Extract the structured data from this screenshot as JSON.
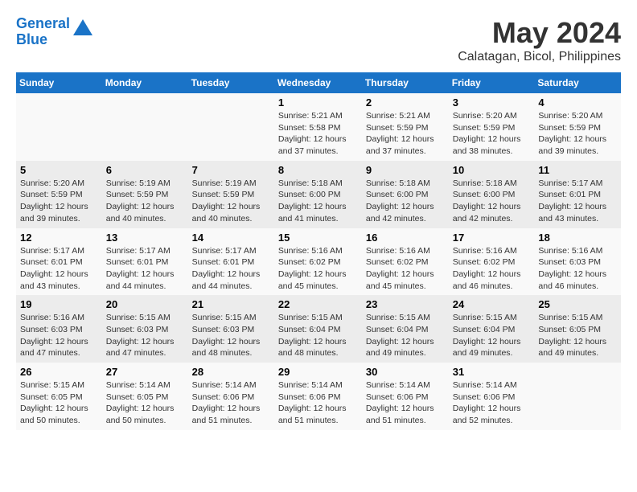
{
  "header": {
    "logo_line1": "General",
    "logo_line2": "Blue",
    "month": "May 2024",
    "location": "Calatagan, Bicol, Philippines"
  },
  "weekdays": [
    "Sunday",
    "Monday",
    "Tuesday",
    "Wednesday",
    "Thursday",
    "Friday",
    "Saturday"
  ],
  "weeks": [
    [
      {
        "day": "",
        "info": ""
      },
      {
        "day": "",
        "info": ""
      },
      {
        "day": "",
        "info": ""
      },
      {
        "day": "1",
        "info": "Sunrise: 5:21 AM\nSunset: 5:58 PM\nDaylight: 12 hours and 37 minutes."
      },
      {
        "day": "2",
        "info": "Sunrise: 5:21 AM\nSunset: 5:59 PM\nDaylight: 12 hours and 37 minutes."
      },
      {
        "day": "3",
        "info": "Sunrise: 5:20 AM\nSunset: 5:59 PM\nDaylight: 12 hours and 38 minutes."
      },
      {
        "day": "4",
        "info": "Sunrise: 5:20 AM\nSunset: 5:59 PM\nDaylight: 12 hours and 39 minutes."
      }
    ],
    [
      {
        "day": "5",
        "info": "Sunrise: 5:20 AM\nSunset: 5:59 PM\nDaylight: 12 hours and 39 minutes."
      },
      {
        "day": "6",
        "info": "Sunrise: 5:19 AM\nSunset: 5:59 PM\nDaylight: 12 hours and 40 minutes."
      },
      {
        "day": "7",
        "info": "Sunrise: 5:19 AM\nSunset: 5:59 PM\nDaylight: 12 hours and 40 minutes."
      },
      {
        "day": "8",
        "info": "Sunrise: 5:18 AM\nSunset: 6:00 PM\nDaylight: 12 hours and 41 minutes."
      },
      {
        "day": "9",
        "info": "Sunrise: 5:18 AM\nSunset: 6:00 PM\nDaylight: 12 hours and 42 minutes."
      },
      {
        "day": "10",
        "info": "Sunrise: 5:18 AM\nSunset: 6:00 PM\nDaylight: 12 hours and 42 minutes."
      },
      {
        "day": "11",
        "info": "Sunrise: 5:17 AM\nSunset: 6:01 PM\nDaylight: 12 hours and 43 minutes."
      }
    ],
    [
      {
        "day": "12",
        "info": "Sunrise: 5:17 AM\nSunset: 6:01 PM\nDaylight: 12 hours and 43 minutes."
      },
      {
        "day": "13",
        "info": "Sunrise: 5:17 AM\nSunset: 6:01 PM\nDaylight: 12 hours and 44 minutes."
      },
      {
        "day": "14",
        "info": "Sunrise: 5:17 AM\nSunset: 6:01 PM\nDaylight: 12 hours and 44 minutes."
      },
      {
        "day": "15",
        "info": "Sunrise: 5:16 AM\nSunset: 6:02 PM\nDaylight: 12 hours and 45 minutes."
      },
      {
        "day": "16",
        "info": "Sunrise: 5:16 AM\nSunset: 6:02 PM\nDaylight: 12 hours and 45 minutes."
      },
      {
        "day": "17",
        "info": "Sunrise: 5:16 AM\nSunset: 6:02 PM\nDaylight: 12 hours and 46 minutes."
      },
      {
        "day": "18",
        "info": "Sunrise: 5:16 AM\nSunset: 6:03 PM\nDaylight: 12 hours and 46 minutes."
      }
    ],
    [
      {
        "day": "19",
        "info": "Sunrise: 5:16 AM\nSunset: 6:03 PM\nDaylight: 12 hours and 47 minutes."
      },
      {
        "day": "20",
        "info": "Sunrise: 5:15 AM\nSunset: 6:03 PM\nDaylight: 12 hours and 47 minutes."
      },
      {
        "day": "21",
        "info": "Sunrise: 5:15 AM\nSunset: 6:03 PM\nDaylight: 12 hours and 48 minutes."
      },
      {
        "day": "22",
        "info": "Sunrise: 5:15 AM\nSunset: 6:04 PM\nDaylight: 12 hours and 48 minutes."
      },
      {
        "day": "23",
        "info": "Sunrise: 5:15 AM\nSunset: 6:04 PM\nDaylight: 12 hours and 49 minutes."
      },
      {
        "day": "24",
        "info": "Sunrise: 5:15 AM\nSunset: 6:04 PM\nDaylight: 12 hours and 49 minutes."
      },
      {
        "day": "25",
        "info": "Sunrise: 5:15 AM\nSunset: 6:05 PM\nDaylight: 12 hours and 49 minutes."
      }
    ],
    [
      {
        "day": "26",
        "info": "Sunrise: 5:15 AM\nSunset: 6:05 PM\nDaylight: 12 hours and 50 minutes."
      },
      {
        "day": "27",
        "info": "Sunrise: 5:14 AM\nSunset: 6:05 PM\nDaylight: 12 hours and 50 minutes."
      },
      {
        "day": "28",
        "info": "Sunrise: 5:14 AM\nSunset: 6:06 PM\nDaylight: 12 hours and 51 minutes."
      },
      {
        "day": "29",
        "info": "Sunrise: 5:14 AM\nSunset: 6:06 PM\nDaylight: 12 hours and 51 minutes."
      },
      {
        "day": "30",
        "info": "Sunrise: 5:14 AM\nSunset: 6:06 PM\nDaylight: 12 hours and 51 minutes."
      },
      {
        "day": "31",
        "info": "Sunrise: 5:14 AM\nSunset: 6:06 PM\nDaylight: 12 hours and 52 minutes."
      },
      {
        "day": "",
        "info": ""
      }
    ]
  ]
}
